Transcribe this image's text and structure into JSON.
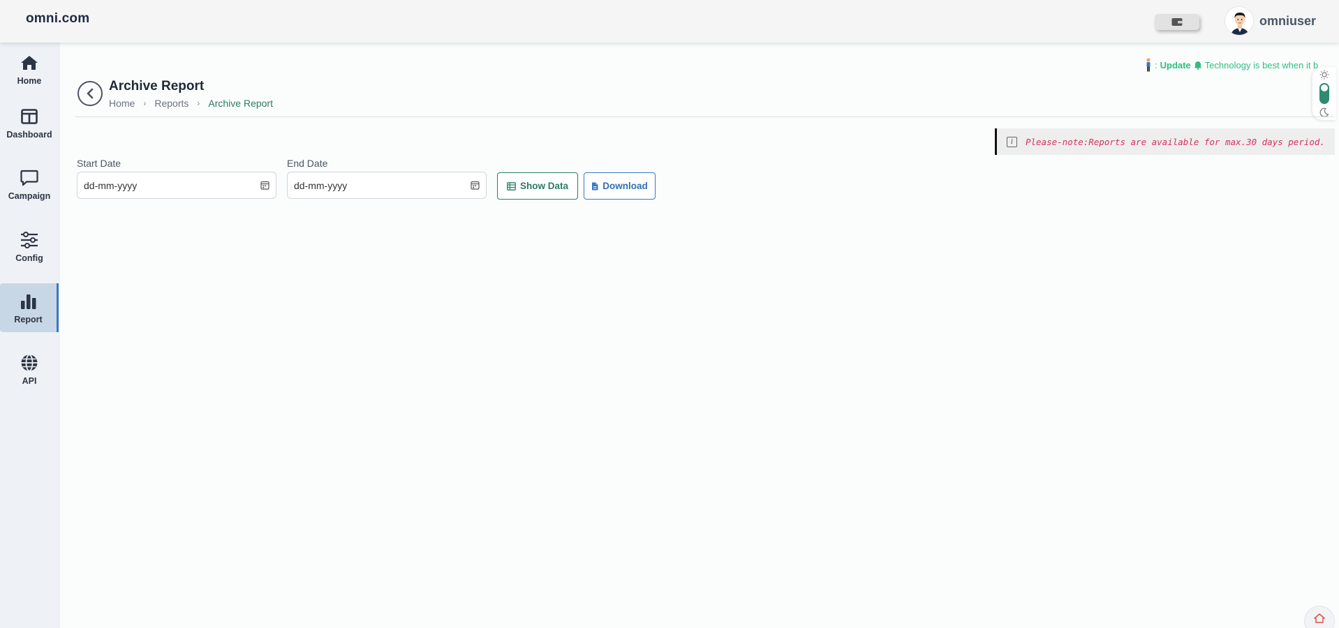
{
  "header": {
    "brand": "omni.com",
    "username": "omniuser"
  },
  "sidebar": {
    "items": [
      {
        "label": "Home",
        "icon": "home-icon"
      },
      {
        "label": "Dashboard",
        "icon": "dashboard-icon"
      },
      {
        "label": "Campaign",
        "icon": "chat-icon"
      },
      {
        "label": "Config",
        "icon": "sliders-icon"
      },
      {
        "label": "Report",
        "icon": "bar-chart-icon",
        "active": true
      },
      {
        "label": "API",
        "icon": "globe-icon"
      }
    ]
  },
  "ticker": {
    "prefix": ": ",
    "update_label": "Update",
    "message": "Technology is best when it b"
  },
  "page": {
    "title": "Archive Report",
    "breadcrumb": [
      "Home",
      "Reports",
      "Archive Report"
    ]
  },
  "note": {
    "text": "Please-note:Reports are available for max.30 days period."
  },
  "form": {
    "start_label": "Start Date",
    "start_placeholder": "dd-mm-yyyy",
    "end_label": "End Date",
    "end_placeholder": "dd-mm-yyyy",
    "show_data_label": "Show Data",
    "download_label": "Download"
  },
  "colors": {
    "accent_green": "#2a7d63",
    "accent_blue": "#3a78c2",
    "note_text": "#d6305e",
    "ticker_text": "#2dbf7e"
  }
}
